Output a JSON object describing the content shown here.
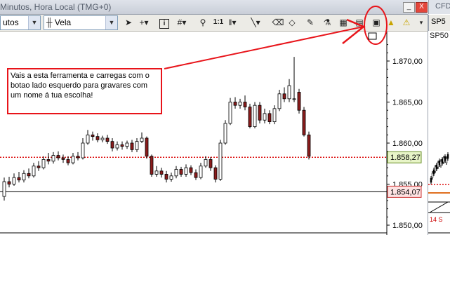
{
  "window": {
    "title": "Minutos, Hora Local (TMG+0)",
    "minimize": "_",
    "close": "X"
  },
  "right_window": {
    "title": "CFD",
    "symbol": "SP5",
    "symbol2": "SP50",
    "bottom_label": "14 S"
  },
  "toolbar": {
    "interval": "utos",
    "chart_type": "Vela",
    "one_to_one": "1:1"
  },
  "chart": {
    "price_labels": [
      "1.870,00",
      "1.865,00",
      "1.860,00",
      "1.855,00",
      "1.850,00"
    ],
    "current_price": "1.858,27",
    "line_price": "1.854,07"
  },
  "annotation": {
    "text": "Vais a esta ferramenta e carregas com o botao lado esquerdo para gravares com um nome á tua escolha!"
  },
  "colors": {
    "annotation_red": "#e8141a",
    "candle_up": "#ffffff",
    "candle_down": "#8b1c1c",
    "price_box_green": "#e8f5c8",
    "price_box_red": "#fde2e2"
  }
}
